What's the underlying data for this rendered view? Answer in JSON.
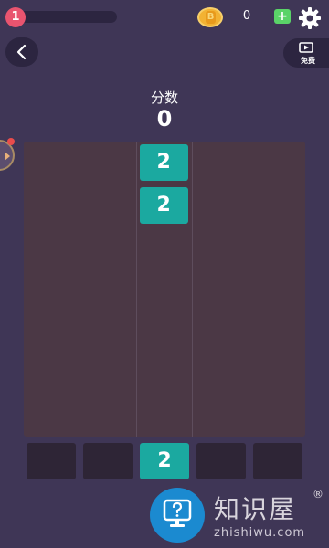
{
  "header": {
    "level": "1",
    "level_progress": 0,
    "coin_symbol": "B",
    "coins": "0",
    "add_symbol": "+"
  },
  "actions": {
    "free_label": "免费"
  },
  "score": {
    "title": "分数",
    "value": "0"
  },
  "board": {
    "columns": 5,
    "tiles": [
      {
        "column": 3,
        "row": 1,
        "value": "2"
      },
      {
        "column": 3,
        "row": 2,
        "value": "2"
      }
    ]
  },
  "queue": {
    "slots": [
      "",
      "",
      "2",
      "",
      ""
    ]
  },
  "watermark": {
    "title": "知识屋",
    "registered": "®",
    "subtitle": "zhishiwu.com"
  },
  "colors": {
    "background": "#3f3656",
    "board": "#4b3845",
    "tile": "#1ba9a0",
    "accent_red": "#e9546f",
    "coin": "#f2b233",
    "add_green": "#5ad368"
  },
  "icons": {
    "back": "chevron-left-icon",
    "settings": "gear-icon",
    "video": "video-play-icon",
    "side": "chevron-right-icon",
    "coin": "coin-icon"
  }
}
